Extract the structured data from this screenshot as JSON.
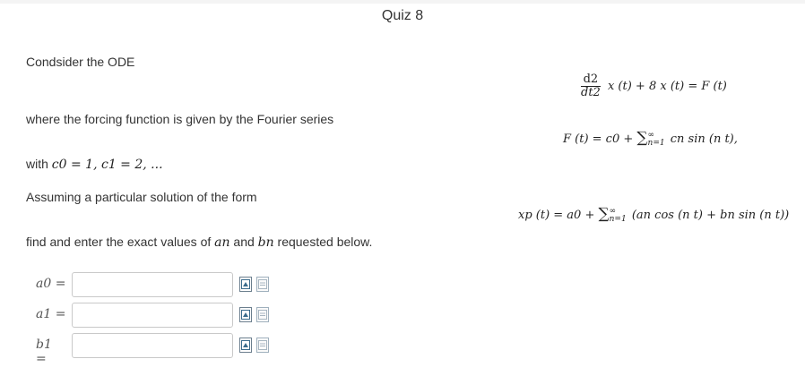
{
  "quiz": {
    "title": "Quiz 8"
  },
  "problem": {
    "intro": "Condsider the ODE",
    "ode": {
      "numerator": "d2",
      "denominator": "dt2",
      "rhs": "x (t) + 8 x (t) = F (t)"
    },
    "forcing_text": "where the forcing function is given by the Fourier series",
    "fourier": {
      "lhs": "F (t) = c0 + ",
      "upper": "∞",
      "lower": "n=1",
      "term": "cn sin (n t),"
    },
    "with_prefix": "with",
    "coefficients": "c0 = 1, c1 = 2, ...",
    "assume_text": "Assuming a particular solution of the form",
    "particular": {
      "lhs": "xp (t) = a0 + ",
      "upper": "∞",
      "lower": "n=1",
      "term": "(an cos (n t) + bn sin (n t))"
    },
    "find_prefix": "find and enter the exact values of",
    "find_a": "an",
    "find_and": "and",
    "find_b": "bn",
    "find_suffix": "requested below."
  },
  "answers": [
    {
      "label": "a0 =",
      "value": "",
      "icons": [
        "preview-icon",
        "help-icon"
      ]
    },
    {
      "label": "a1 =",
      "value": "",
      "icons": [
        "preview-icon",
        "help-icon"
      ]
    },
    {
      "label": "b1 =",
      "value": "",
      "icons": [
        "preview-icon",
        "help-icon"
      ]
    }
  ]
}
